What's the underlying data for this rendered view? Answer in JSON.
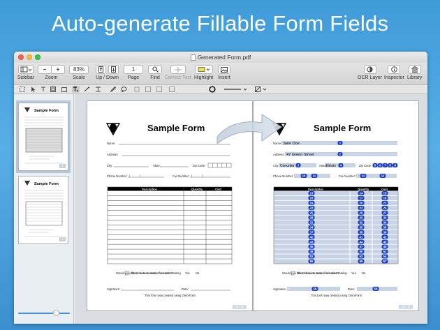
{
  "headline": "Auto-generate Fillable Form Fields",
  "window": {
    "title": "Generated Form.pdf"
  },
  "toolbar": {
    "sidebar_label": "Sidebar",
    "zoom_label": "Zoom",
    "zoom_minus": "−",
    "zoom_plus": "+",
    "scale_value": "83%",
    "scale_label": "Scale",
    "updown_label": "Up / Down",
    "page_value": "1",
    "page_label": "Page",
    "find_label": "Find",
    "correct_text_label": "Correct Text",
    "highlight_label": "Highlight",
    "insert_label": "Insert",
    "ocr_label": "OCR Layer",
    "inspector_label": "Inspector",
    "library_label": "Library"
  },
  "thumbnails": [
    {
      "title": "Sample Form",
      "page": "1"
    },
    {
      "title": "Sample Form",
      "page": "2"
    }
  ],
  "form": {
    "title": "Sample Form",
    "name_label": "Name:",
    "address_label": "Address:",
    "city_label": "City:",
    "state_label": "State:",
    "zip_label": "Zip Code:",
    "phone_label": "Phone Number:",
    "fax_label": "Fax Number:",
    "col_description": "Description",
    "col_quantity": "Quantity",
    "col_cost": "Cost",
    "checkbox_label": "Check here to receive our next catalog",
    "info_question": "Would you like to receive more information?",
    "yes_label": "Yes",
    "no_label": "No",
    "signature_label": "Signature:",
    "date_label": "Date:",
    "footer": "This form was created using OmniForm",
    "page_indicator": "1 / 2"
  },
  "filled": {
    "name_value": "Jane Doe",
    "address_value": "47 Green Street",
    "city_value": "Conurbia",
    "state_value": "Illinois",
    "field_ids": {
      "name": "1",
      "address": "2",
      "city": "3",
      "state": "4",
      "zip": [
        "5",
        "6",
        "7",
        "8",
        "9"
      ],
      "phone": [
        "10",
        "11"
      ],
      "fax": [
        "11",
        "12"
      ],
      "signature": "58",
      "date": "59"
    },
    "rows_desc_start": 13,
    "rows_qty_start": 14,
    "rows_cost_start": 15,
    "row_count": 15,
    "page_indicator": "1 / 2"
  },
  "colors": {
    "accent": "#4b94e0",
    "badge": "#1a3fc4",
    "field": "#c8d3e6"
  }
}
